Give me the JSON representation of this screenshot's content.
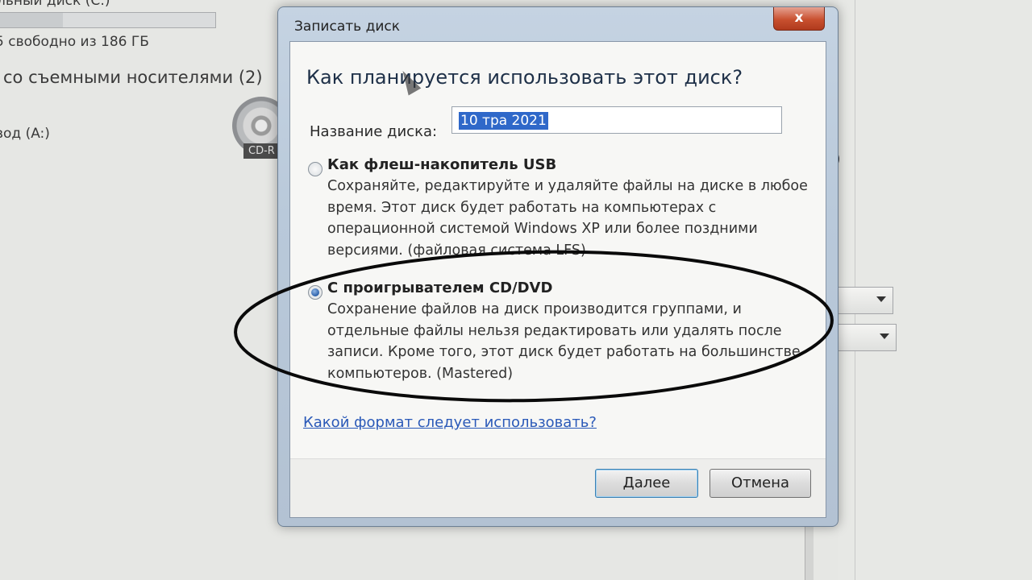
{
  "background": {
    "top_cut_text": "льный диск (C:)",
    "free_space": "5 свободно из 186 ГБ",
    "removable_group": "со съемными носителями (2)",
    "floppy": "вод (A:)",
    "cd_label": "CD-R",
    "right_paren": "l)"
  },
  "dialog": {
    "title": "Записать диск",
    "close_label": "x",
    "heading": "Как планируется использовать этот диск?",
    "disc_name_label": "Название диска:",
    "disc_name_value": "10 тра 2021",
    "options": [
      {
        "title": "Как флеш-накопитель USB",
        "checked": false,
        "description": "Сохраняйте, редактируйте и удаляйте файлы на диске в любое время. Этот диск будет работать на компьютерах с операционной системой Windows XP или более поздними версиями. (файловая система LFS)"
      },
      {
        "title": "С проигрывателем CD/DVD",
        "checked": true,
        "description": "Сохранение файлов на диск производится группами, и отдельные файлы нельзя редактировать или удалять после записи. Кроме того, этот диск будет работать на большинстве компьютеров. (Mastered)"
      }
    ],
    "help_link": "Какой формат следует использовать?",
    "next_button": "Далее",
    "cancel_button": "Отмена"
  },
  "colors": {
    "selection": "#2f68c9",
    "link": "#2a59b8",
    "close_button": "#c8502f",
    "frame": "#b9c9da"
  }
}
